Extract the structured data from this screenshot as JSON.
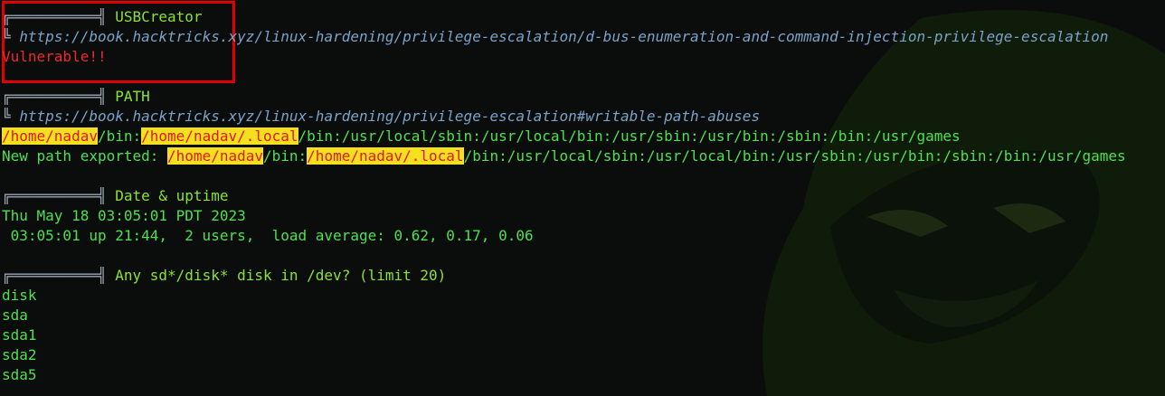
{
  "sections": {
    "usbcreator": {
      "header_glyph": "╔══════════╣",
      "title": "USBCreator",
      "url_prefix": "╚",
      "url": "https://book.hacktricks.xyz/linux-hardening/privilege-escalation/d-bus-enumeration-and-command-injection-privilege-escalation",
      "status": "Vulnerable!!"
    },
    "path": {
      "header_glyph": "╔══════════╣",
      "title": "PATH",
      "url_prefix": "╚",
      "url": "https://book.hacktricks.xyz/linux-hardening/privilege-escalation#writable-path-abuses",
      "line1": {
        "seg1": "/home/nadav",
        "seg2": "/bin:",
        "seg3": "/home/nadav/.local",
        "seg4": "/bin:/usr/local/sbin:/usr/local/bin:/usr/sbin:/usr/bin:/sbin:/bin:/usr/games"
      },
      "line2": {
        "prefix": "New path exported: ",
        "seg1": "/home/nadav",
        "seg2": "/bin:",
        "seg3": "/home/nadav/.local",
        "seg4": "/bin:/usr/local/sbin:/usr/local/bin:/usr/sbin:/usr/bin:/sbin:/bin:/usr/games"
      }
    },
    "date": {
      "header_glyph": "╔══════════╣",
      "title": "Date & uptime",
      "date_line": "Thu May 18 03:05:01 PDT 2023",
      "uptime_line": " 03:05:01 up 21:44,  2 users,  load average: 0.62, 0.17, 0.06"
    },
    "disks": {
      "header_glyph": "╔══════════╣",
      "title": "Any sd*/disk* disk in /dev? (limit 20)",
      "items": [
        "disk",
        "sda",
        "sda1",
        "sda2",
        "sda5"
      ]
    }
  },
  "colors": {
    "background": "#0b0d0c",
    "title_green": "#8ae234",
    "output_green": "#4ee04e",
    "url_blue": "#7aa2c8",
    "vulnerable_red": "#ef2929",
    "highlight_yellow": "#f5e020",
    "highlight_text": "#e01818",
    "annotation_box": "#e00000"
  }
}
